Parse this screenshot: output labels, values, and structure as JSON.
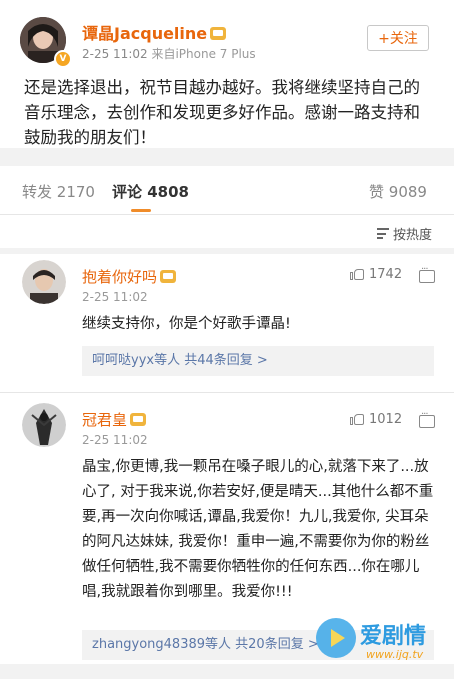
{
  "post": {
    "author": "谭晶Jacqueline",
    "time": "2-25 11:02",
    "device": "来自iPhone 7 Plus",
    "follow_label": "+关注",
    "text": "还是选择退出，祝节目越办越好。我将继续坚持自己的音乐理念，去创作和发现更多好作品。感谢一路支持和鼓励我的朋友们！"
  },
  "tabs": {
    "repost_label": "转发",
    "repost_count": "2170",
    "comment_label": "评论",
    "comment_count": "4808",
    "like_label": "赞",
    "like_count": "9089"
  },
  "sort_label": "按热度",
  "comments": [
    {
      "name": "抱着你好吗",
      "time": "2-25 11:02",
      "likes": "1742",
      "text": "继续支持你，你是个好歌手谭晶!",
      "replies": "呵呵哒yyx等人  共44条回复 >"
    },
    {
      "name": "冠君皇",
      "time": "2-25 11:02",
      "likes": "1012",
      "text": "晶宝,你更博,我一颗吊在嗓子眼儿的心,就落下来了...放心了, 对于我来说,你若安好,便是晴天...其他什么都不重要,再一次向你喊话,谭晶,我爱你！九儿,我爱你, 尖耳朵的阿凡达妹妹, 我爱你！重申一遍,不需要你为你的粉丝做任何牺牲,我不需要你牺牲你的任何东西...你在哪儿唱,我就跟着你到哪里。我爱你!!!",
      "replies": "zhangyong48389等人  共20条回复 >"
    }
  ],
  "watermark": {
    "text": "爱剧情",
    "url": "www.ijq.tv"
  },
  "colors": {
    "accent": "#e8660c",
    "link": "#5b77a8",
    "divider_bg": "#f2f2f2"
  }
}
